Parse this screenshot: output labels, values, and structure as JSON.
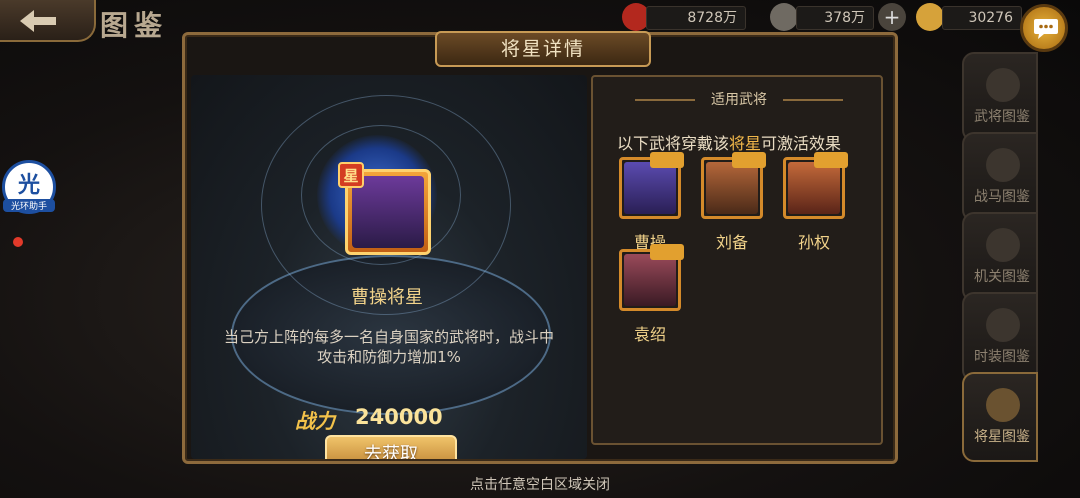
{
  "header": {
    "page_title": "图鉴",
    "resources": [
      {
        "icon": "flag-icon",
        "value": "8728万"
      },
      {
        "icon": "coin-icon",
        "value": "378万"
      },
      {
        "icon": "ingot-icon",
        "value": "30276"
      }
    ]
  },
  "side_tabs": [
    {
      "label": "武将图鉴",
      "icon": "taiji-icon"
    },
    {
      "label": "战马图鉴",
      "icon": "horse-icon"
    },
    {
      "label": "机关图鉴",
      "icon": "dragon-icon"
    },
    {
      "label": "时装图鉴",
      "icon": "armor-icon"
    },
    {
      "label": "将星图鉴",
      "icon": "star-icon"
    }
  ],
  "helper": {
    "big": "光",
    "small": "光环助手"
  },
  "dialog": {
    "title": "将星详情",
    "star": {
      "badge": "星",
      "name": "曹操将星",
      "effect": "当己方上阵的每多一名自身国家的武将时，战斗中攻击和防御力增加1%",
      "power_label": "战力",
      "power_value": "240000",
      "get_button": "去获取"
    },
    "applicable": {
      "title": "适用武将",
      "desc_prefix": "以下武将穿戴该",
      "desc_highlight": "将星",
      "desc_suffix": "可激活效果",
      "heroes": [
        {
          "name": "曹操",
          "color": "#4a3a8a"
        },
        {
          "name": "刘备",
          "color": "#8a4a2a"
        },
        {
          "name": "孙权",
          "color": "#9a3a2a"
        },
        {
          "name": "袁绍",
          "color": "#7a3a4a"
        }
      ]
    }
  },
  "footer": {
    "hint": "点击任意空白区域关闭"
  }
}
